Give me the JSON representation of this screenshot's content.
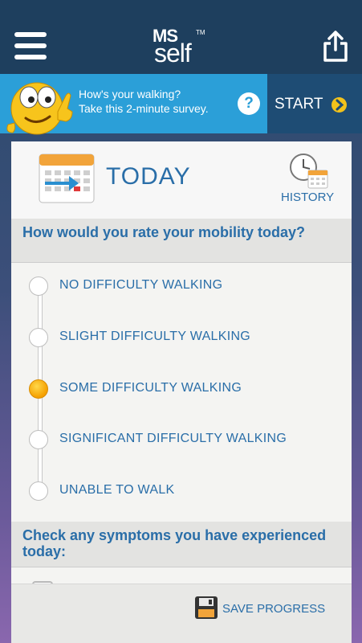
{
  "header": {
    "logo_ms": "MS",
    "logo_self": "self",
    "logo_tm": "TM"
  },
  "banner": {
    "line1": "How's your walking?",
    "line2": "Take this 2-minute survey.",
    "help": "?",
    "start_label": "START"
  },
  "card": {
    "title": "TODAY",
    "history_label": "HISTORY",
    "question1": "How would you rate your mobility today?",
    "options": [
      {
        "label": "NO DIFFICULTY WALKING",
        "selected": false
      },
      {
        "label": "SLIGHT DIFFICULTY WALKING",
        "selected": false
      },
      {
        "label": "SOME DIFFICULTY WALKING",
        "selected": true
      },
      {
        "label": "SIGNIFICANT DIFFICULTY WALKING",
        "selected": false
      },
      {
        "label": "UNABLE TO WALK",
        "selected": false
      }
    ],
    "question2": "Check any symptoms you have experienced today:"
  },
  "footer": {
    "save_label": "SAVE PROGRESS"
  },
  "colors": {
    "accent": "#2a6ea8",
    "topbar": "#1e3f5e",
    "banner": "#2b9fd8",
    "start_bg": "#1e4c74",
    "selected": "#f5a000"
  }
}
